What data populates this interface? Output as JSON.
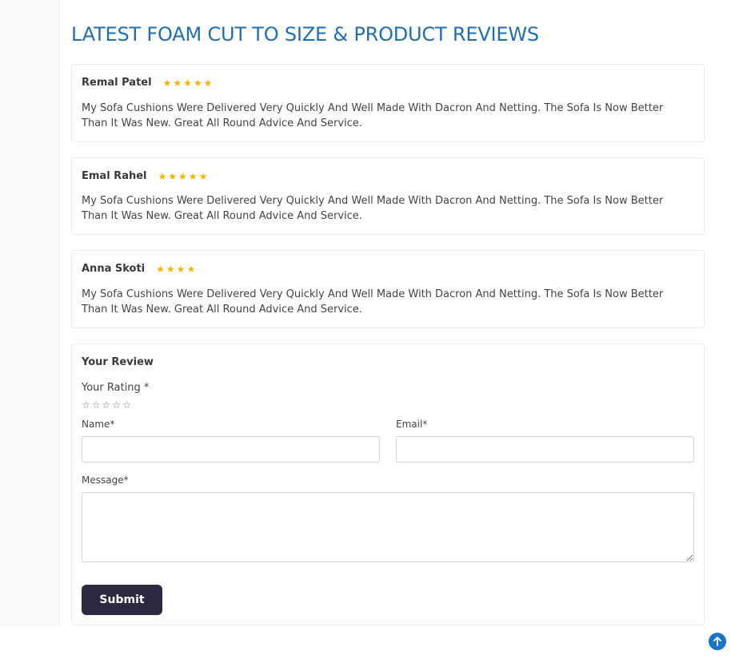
{
  "page": {
    "title": "LATEST FOAM CUT TO SIZE & PRODUCT REVIEWS"
  },
  "reviews": [
    {
      "name": "Remal Patel",
      "rating": 5,
      "text": "My Sofa Cushions Were Delivered Very Quickly And Well Made With Dacron And Netting. The Sofa Is Now Better Than It Was New. Great All Round Advice And Service."
    },
    {
      "name": "Emal Rahel",
      "rating": 5,
      "text": "My Sofa Cushions Were Delivered Very Quickly And Well Made With Dacron And Netting. The Sofa Is Now Better Than It Was New. Great All Round Advice And Service."
    },
    {
      "name": "Anna Skoti",
      "rating": 4,
      "text": "My Sofa Cushions Were Delivered Very Quickly And Well Made With Dacron And Netting. The Sofa Is Now Better Than It Was New. Great All Round Advice And Service."
    }
  ],
  "review_form": {
    "title": "Your Review",
    "rating_label": "Your Rating *",
    "rating_value": 0,
    "rating_max": 5,
    "name_label": "Name*",
    "name_value": "",
    "email_label": "Email*",
    "email_value": "",
    "message_label": "Message*",
    "message_value": "",
    "submit_label": "Submit"
  },
  "icons": {
    "filled_star": "star-icon",
    "empty_star": "star-outline-icon",
    "scroll_top": "arrow-up-icon"
  },
  "colors": {
    "title": "#1f6fb5",
    "star": "#f5b400",
    "submit_bg": "#2d2941",
    "scroll_top_bg": "#1a73c9"
  }
}
